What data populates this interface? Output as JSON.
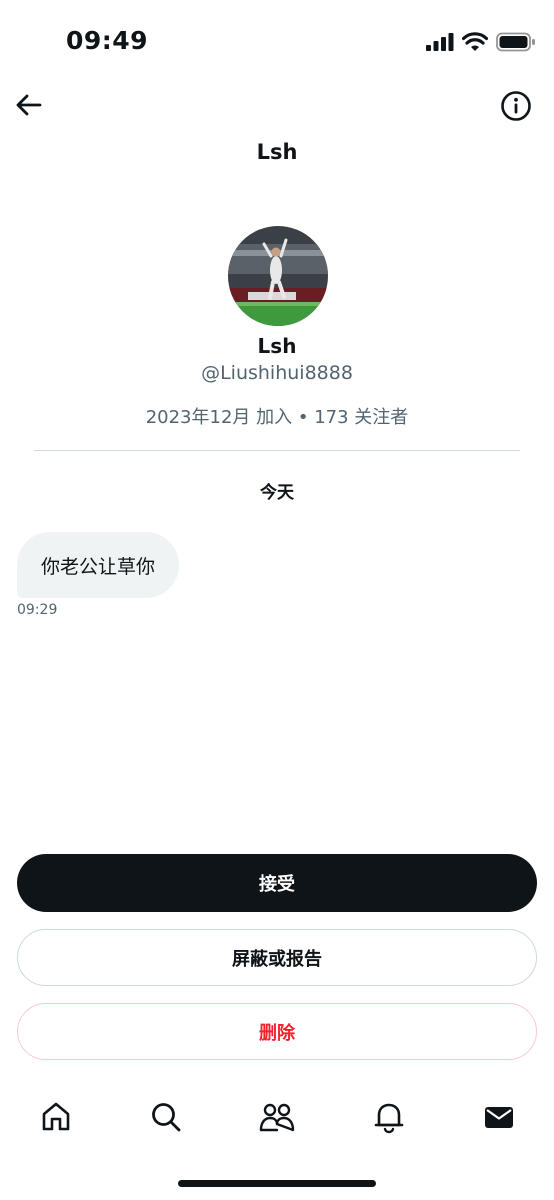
{
  "status_bar": {
    "time": "09:49"
  },
  "header": {
    "title": "Lsh"
  },
  "profile": {
    "name": "Lsh",
    "handle": "@Liushihui8888",
    "meta": "2023年12月 加入 • 173 关注者"
  },
  "conversation": {
    "date_separator": "今天",
    "messages": [
      {
        "text": "你老公让草你",
        "time": "09:29"
      }
    ]
  },
  "actions": {
    "accept_label": "接受",
    "block_report_label": "屏蔽或报告",
    "delete_label": "删除"
  },
  "colors": {
    "text": "#0f1419",
    "secondary": "#536471",
    "danger": "#f4212e",
    "bubble": "#eff3f4"
  },
  "tab_bar": [
    "home-icon",
    "search-icon",
    "communities-icon",
    "notifications-icon",
    "messages-icon"
  ]
}
